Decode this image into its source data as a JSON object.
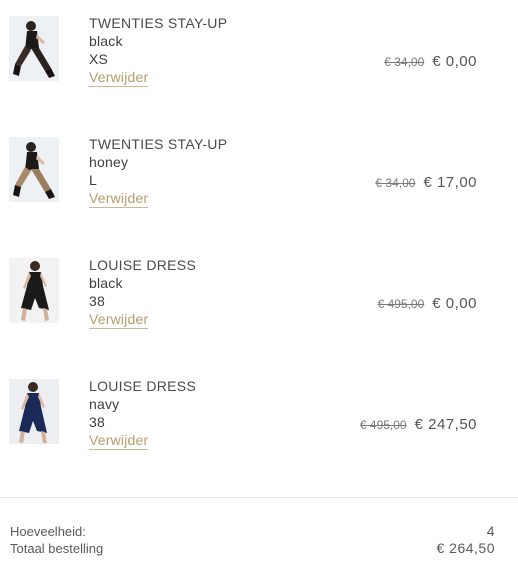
{
  "cart": {
    "items": [
      {
        "name": "TWENTIES STAY-UP",
        "color": "black",
        "size": "XS",
        "remove_label": "Verwijder",
        "old_price": "€ 34,00",
        "new_price": "€ 0,00",
        "thumb_icon": "stockings-model-photo"
      },
      {
        "name": "TWENTIES STAY-UP",
        "color": "honey",
        "size": "L",
        "remove_label": "Verwijder",
        "old_price": "€ 34,00",
        "new_price": "€ 17,00",
        "thumb_icon": "stockings-model-photo"
      },
      {
        "name": "LOUISE DRESS",
        "color": "black",
        "size": "38",
        "remove_label": "Verwijder",
        "old_price": "€ 495,00",
        "new_price": "€ 0,00",
        "thumb_icon": "dress-model-photo"
      },
      {
        "name": "LOUISE DRESS",
        "color": "navy",
        "size": "38",
        "remove_label": "Verwijder",
        "old_price": "€ 495,00",
        "new_price": "€ 247,50",
        "thumb_icon": "dress-model-photo"
      }
    ]
  },
  "summary": {
    "quantity_label": "Hoeveelheid:",
    "quantity_value": "4",
    "total_label": "Totaal bestelling",
    "total_value": "€ 264,50"
  },
  "colors": {
    "link": "#b59c6a",
    "text": "#3a3a3a",
    "navy_dress": "#1c2a5a",
    "black_dress": "#1a1a1a"
  }
}
